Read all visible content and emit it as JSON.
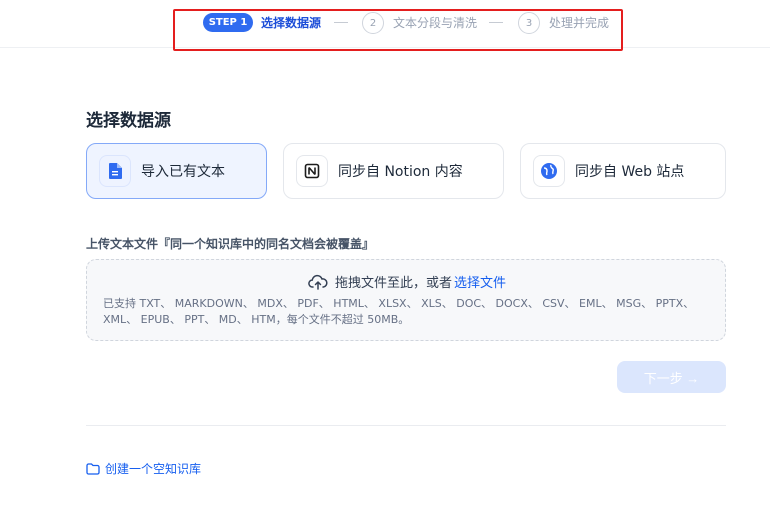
{
  "stepper": {
    "step1_badge": "STEP 1",
    "step1_label": "选择数据源",
    "step2_num": "2",
    "step2_label": "文本分段与清洗",
    "step3_num": "3",
    "step3_label": "处理并完成"
  },
  "main": {
    "title": "选择数据源",
    "sources": [
      {
        "label": "导入已有文本",
        "icon": "document-icon"
      },
      {
        "label": "同步自 Notion 内容",
        "icon": "notion-icon"
      },
      {
        "label": "同步自 Web 站点",
        "icon": "web-globe-icon"
      }
    ],
    "upload_title": "上传文本文件『同一个知识库中的同名文档会被覆盖』",
    "dropzone_text": "拖拽文件至此，或者",
    "dropzone_link": "选择文件",
    "dropzone_support": "已支持 TXT、 MARKDOWN、 MDX、 PDF、 HTML、 XLSX、 XLS、 DOC、 DOCX、 CSV、 EML、 MSG、 PPTX、 XML、 EPUB、 PPT、 MD、 HTM，每个文件不超过 50MB。",
    "next_label": "下一步 →",
    "create_empty_label": "创建一个空知识库"
  },
  "colors": {
    "accent": "#2f6bf0",
    "highlight_border": "#e41e1e",
    "link": "#155eef"
  }
}
